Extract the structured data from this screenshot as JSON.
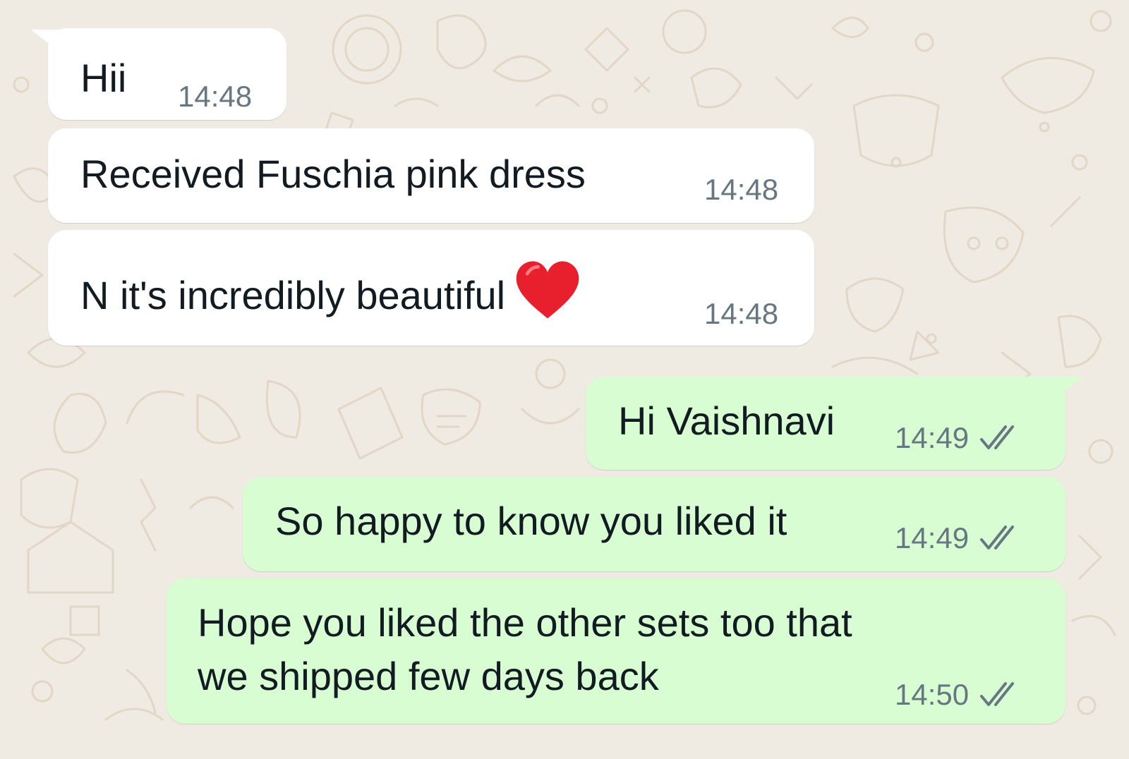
{
  "chat": {
    "colors": {
      "wallpaper": "#efeae2",
      "incoming_bubble": "#ffffff",
      "outgoing_bubble": "#d9fdd3",
      "text": "#111b21",
      "timestamp": "#667781",
      "read_ticks": "#667781",
      "heart": "#e8202e"
    },
    "messages": [
      {
        "direction": "incoming",
        "text": "Hii",
        "time": "14:48"
      },
      {
        "direction": "incoming",
        "text": "Received Fuschia pink dress",
        "time": "14:48"
      },
      {
        "direction": "incoming",
        "text": "N it's incredibly beautiful",
        "emoji": "heart-icon",
        "time": "14:48"
      },
      {
        "direction": "outgoing",
        "text": "Hi Vaishnavi",
        "time": "14:49",
        "status": "double-tick-icon"
      },
      {
        "direction": "outgoing",
        "text": "So happy to know you liked it",
        "time": "14:49",
        "status": "double-tick-icon"
      },
      {
        "direction": "outgoing",
        "lines": [
          "Hope you liked the other sets too that",
          "we shipped few days back"
        ],
        "time": "14:50",
        "status": "double-tick-icon"
      }
    ]
  }
}
